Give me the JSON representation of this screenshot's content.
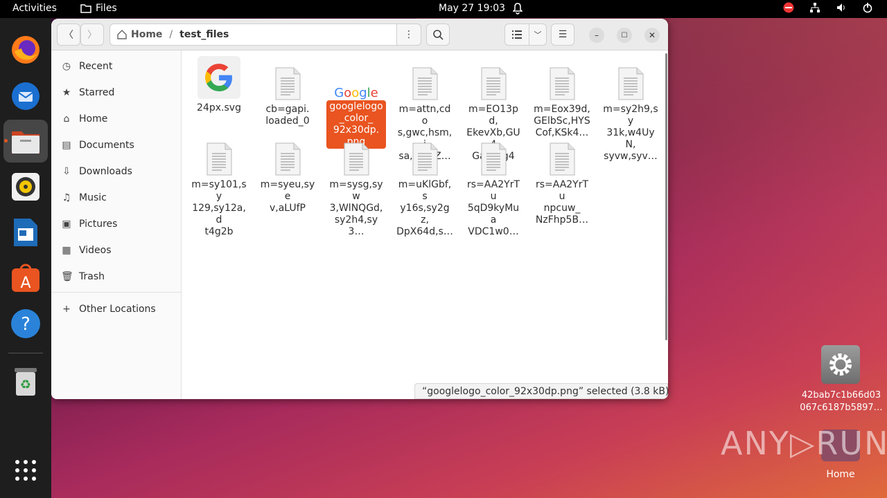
{
  "topbar": {
    "activities": "Activities",
    "app_name": "Files",
    "clock": "May 27  19:03"
  },
  "window": {
    "path_home": "Home",
    "path_current": "test_files",
    "sidebar": [
      {
        "label": "Recent",
        "icon": "clock-icon"
      },
      {
        "label": "Starred",
        "icon": "star-icon"
      },
      {
        "label": "Home",
        "icon": "home-icon"
      },
      {
        "label": "Documents",
        "icon": "document-icon"
      },
      {
        "label": "Downloads",
        "icon": "download-icon"
      },
      {
        "label": "Music",
        "icon": "music-icon"
      },
      {
        "label": "Pictures",
        "icon": "picture-icon"
      },
      {
        "label": "Videos",
        "icon": "video-icon"
      },
      {
        "label": "Trash",
        "icon": "trash-icon"
      },
      {
        "label": "Other Locations",
        "icon": "plus-icon"
      }
    ],
    "files": [
      {
        "name": "24px.svg",
        "kind": "google-g"
      },
      {
        "name": "cb=gapi.\nloaded_0",
        "kind": "text"
      },
      {
        "name": "googlelogo\n_color_\n92x30dp.\npng",
        "kind": "google-logo",
        "selected": true
      },
      {
        "name": "m=attn,cdo\ns,gwc,hsm,j\nsa,mb4Z…",
        "kind": "text"
      },
      {
        "name": "m=EO13pd,\nEkevXb,GU4\nGab,Gg40…",
        "kind": "text"
      },
      {
        "name": "m=Eox39d,\nGElbSc,HYS\nCof,KSk4…",
        "kind": "text"
      },
      {
        "name": "m=sy2h9,sy\n31k,w4UyN,\nsyvw,syv…",
        "kind": "text"
      },
      {
        "name": "m=sy101,sy\n129,sy12a,d\nt4g2b",
        "kind": "text"
      },
      {
        "name": "m=syeu,sye\nv,aLUfP",
        "kind": "text"
      },
      {
        "name": "m=sysg,syw\n3,WlNQGd,\nsy2h4,sy3…",
        "kind": "text"
      },
      {
        "name": "m=uKlGbf,s\ny16s,sy2gz,\nDpX64d,s…",
        "kind": "text"
      },
      {
        "name": "rs=AA2YrTu\n5qD9kyMua\nVDC1w0…",
        "kind": "text"
      },
      {
        "name": "rs=AA2YrTu\nnpcuw_\nNzFhp5B…",
        "kind": "text"
      }
    ],
    "status": "“googlelogo_color_92x30dp.png” selected  (3.8 kB)"
  },
  "desktop": {
    "file_label": "42bab7c1b66d03\n067c6187b5897…",
    "home_label": "Home",
    "watermark": "ANY▷RUN"
  },
  "colors": {
    "accent": "#e95420"
  }
}
